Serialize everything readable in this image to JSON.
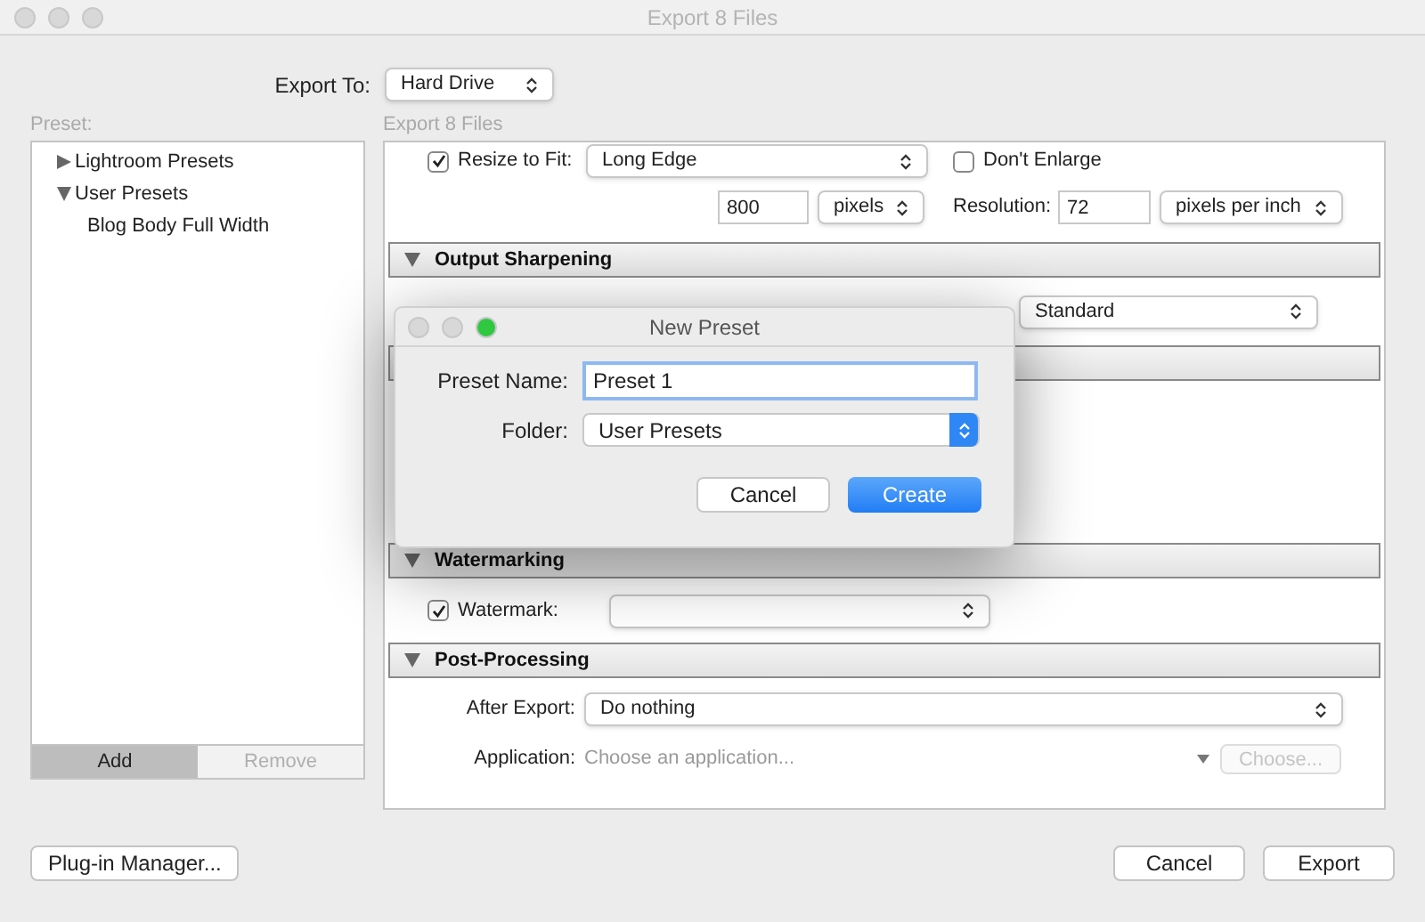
{
  "window": {
    "title": "Export 8 Files"
  },
  "export_to": {
    "label": "Export To:",
    "value": "Hard Drive"
  },
  "preset_panel": {
    "label": "Preset:",
    "tree": [
      {
        "label": "Lightroom Presets",
        "expanded": false
      },
      {
        "label": "User Presets",
        "expanded": true,
        "children": [
          {
            "label": "Blog Body Full Width"
          }
        ]
      }
    ],
    "buttons": [
      {
        "label": "Add",
        "disabled": false
      },
      {
        "label": "Remove",
        "disabled": true
      }
    ]
  },
  "settings": {
    "label": "Export 8 Files",
    "image_sizing": {
      "resize": {
        "label": "Resize to Fit:",
        "checked": true,
        "value": "Long Edge"
      },
      "dont_enlarge": {
        "label": "Don't Enlarge",
        "checked": false
      },
      "size": "800",
      "size_unit": "pixels",
      "resolution_label": "Resolution:",
      "resolution": "72",
      "resolution_unit": "pixels per inch"
    },
    "output_sharpening": {
      "title": "Output Sharpening",
      "expanded": true,
      "amount": "Standard"
    },
    "watermarking": {
      "title": "Watermarking",
      "expanded": true,
      "watermark": {
        "label": "Watermark:",
        "checked": true
      }
    },
    "post_processing": {
      "title": "Post-Processing",
      "expanded": true,
      "after_export_label": "After Export:",
      "after_export": "Do nothing",
      "application_label": "Application:",
      "application_placeholder": "Choose an application...",
      "choose_button": {
        "label": "Choose...",
        "disabled": true
      }
    }
  },
  "buttons": {
    "plugin_manager": "Plug-in Manager...",
    "cancel": "Cancel",
    "export": "Export"
  },
  "new_preset_dialog": {
    "title": "New Preset",
    "name_label": "Preset Name:",
    "name_value": "Preset 1",
    "folder_label": "Folder:",
    "folder_value": "User Presets",
    "cancel": "Cancel",
    "create": "Create"
  }
}
